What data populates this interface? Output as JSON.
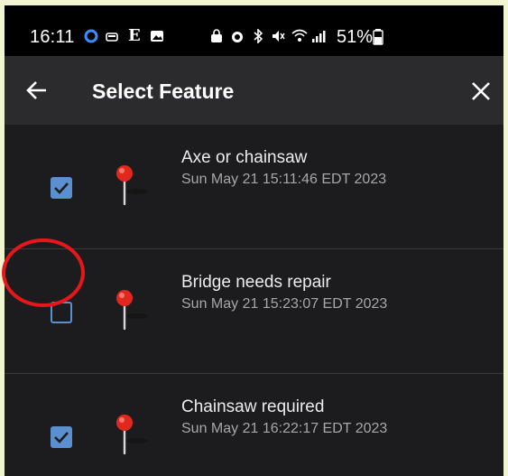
{
  "status_bar": {
    "time": "16:11",
    "battery": "51%",
    "icons": [
      "location-dot-icon",
      "car-icon",
      "e-letter-icon",
      "gallery-icon",
      "lock-icon",
      "alarm-icon",
      "bluetooth-icon",
      "mute-icon",
      "wifi-icon",
      "signal-icon",
      "battery-icon"
    ]
  },
  "app_bar": {
    "title": "Select Feature",
    "back_icon": "arrow-left-icon",
    "close_icon": "close-icon"
  },
  "features": [
    {
      "title": "Axe or chainsaw",
      "date": "Sun May 21 15:11:46 EDT 2023",
      "checked": true
    },
    {
      "title": "Bridge needs repair",
      "date": "Sun May 21 15:23:07 EDT 2023",
      "checked": false
    },
    {
      "title": "Chainsaw required",
      "date": "Sun May 21 16:22:17 EDT 2023",
      "checked": true
    }
  ],
  "colors": {
    "accent": "#5b90d0",
    "pin": "#e0281f",
    "annotation": "#e5171b",
    "background": "#1c1c1e",
    "app_bar": "#2b2b2d"
  }
}
